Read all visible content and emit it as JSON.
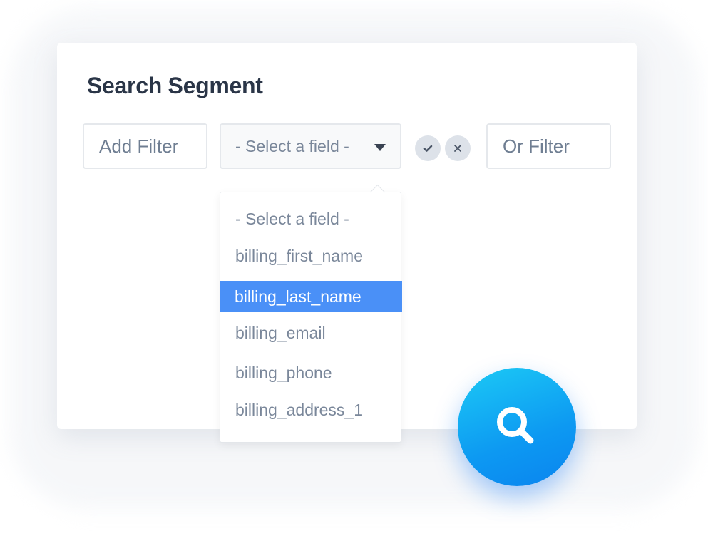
{
  "panel": {
    "title": "Search Segment"
  },
  "filters": {
    "add_filter_label": "Add Filter",
    "field_select_value": "- Select a field -",
    "or_filter_label": "Or Filter"
  },
  "dropdown": {
    "options": [
      "- Select a field -",
      "billing_first_name",
      "billing_last_name",
      "billing_email",
      "billing_phone",
      "billing_address_1"
    ],
    "selected": "billing_last_name"
  },
  "icons": {
    "confirm": "check-icon",
    "clear": "close-icon",
    "search": "search-icon",
    "caret": "caret-down-icon"
  },
  "colors": {
    "title": "#2a3547",
    "text_muted": "#6f7e92",
    "highlight": "#4a90f7",
    "accent_gradient_start": "#1ccaf5",
    "accent_gradient_end": "#0a84ef"
  }
}
